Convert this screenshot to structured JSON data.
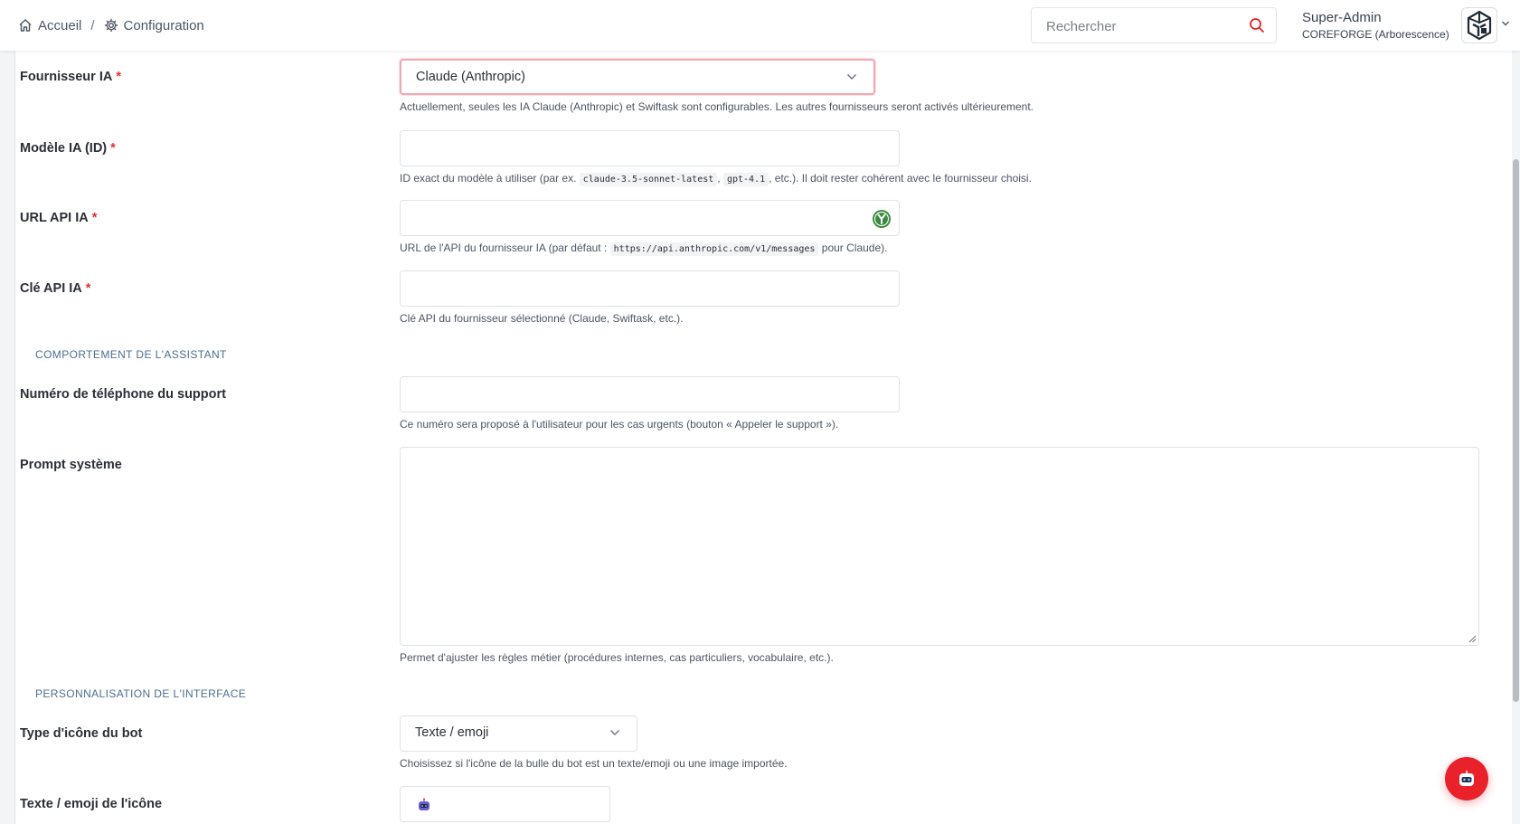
{
  "header": {
    "breadcrumb": [
      {
        "label": "Accueil",
        "icon": "home-icon"
      },
      {
        "label": "Configuration",
        "icon": "gear-icon"
      }
    ],
    "separator": "/",
    "search": {
      "placeholder": "Rechercher",
      "value": ""
    },
    "user": {
      "name": "Super-Admin",
      "organization": "COREFORGE (Arborescence)"
    }
  },
  "form": {
    "provider": {
      "label": "Fournisseur IA",
      "required_mark": "*",
      "value": "Claude (Anthropic)",
      "help": "Actuellement, seules les IA Claude (Anthropic) et Swiftask sont configurables. Les autres fournisseurs seront activés ultérieurement."
    },
    "model": {
      "label": "Modèle IA (ID)",
      "required_mark": "*",
      "value": "",
      "help_prefix": "ID exact du modèle à utiliser (par ex.",
      "help_code_1": "claude-3.5-sonnet-latest",
      "help_sep": ",",
      "help_code_2": "gpt-4.1",
      "help_suffix": ", etc.). Il doit rester cohérent avec le fournisseur choisi."
    },
    "api_url": {
      "label": "URL API IA",
      "required_mark": "*",
      "value": "",
      "help_prefix": "URL de l'API du fournisseur IA (par défaut :",
      "help_code": "https://api.anthropic.com/v1/messages",
      "help_suffix": "pour Claude)."
    },
    "api_key": {
      "label": "Clé API IA",
      "required_mark": "*",
      "value": "",
      "help": "Clé API du fournisseur sélectionné (Claude, Swiftask, etc.)."
    },
    "section_behavior": "COMPORTEMENT DE L'ASSISTANT",
    "support_phone": {
      "label": "Numéro de téléphone du support",
      "value": "",
      "help": "Ce numéro sera proposé à l'utilisateur pour les cas urgents (bouton « Appeler le support »)."
    },
    "system_prompt": {
      "label": "Prompt système",
      "value": "",
      "help": "Permet d'ajuster les règles métier (procédures internes, cas particuliers, vocabulaire, etc.)."
    },
    "section_interface": "PERSONNALISATION DE L'INTERFACE",
    "bot_icon_type": {
      "label": "Type d'icône du bot",
      "value": "Texte / emoji",
      "help": "Choisissez si l'icône de la bulle du bot est un texte/emoji ou une image importée."
    },
    "bot_icon_text": {
      "label": "Texte / emoji de l'icône",
      "value": "🤖"
    }
  },
  "colors": {
    "accent_red": "#e8212a",
    "required_red": "#e03131",
    "section_blue": "#4a6f8f",
    "focus_pink": "#f2a7b1"
  }
}
